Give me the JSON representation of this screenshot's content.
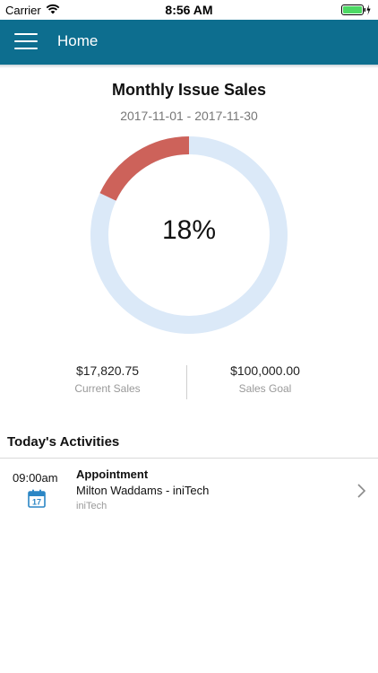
{
  "status_bar": {
    "carrier": "Carrier",
    "time": "8:56 AM",
    "icons": [
      "wifi-icon",
      "battery-icon",
      "charging-bolt-icon"
    ]
  },
  "nav": {
    "title": "Home",
    "menu_icon": "hamburger-menu-icon",
    "color": "#0d6e8f"
  },
  "sales_chart": {
    "title": "Monthly Issue Sales",
    "date_range": "2017-11-01 - 2017-11-30",
    "percent_label": "18%",
    "percent_value": 0.18,
    "progress_color": "#cd625a",
    "track_color": "#dbe9f8"
  },
  "stats": {
    "current_sales_value": "$17,820.75",
    "current_sales_label": "Current Sales",
    "sales_goal_value": "$100,000.00",
    "sales_goal_label": "Sales Goal"
  },
  "activities": {
    "title": "Today's Activities",
    "items": [
      {
        "time": "09:00am",
        "date_icon": "calendar-icon",
        "calendar_day": "17",
        "type": "Appointment",
        "contact": "Milton Waddams - iniTech",
        "company": "iniTech"
      }
    ]
  }
}
